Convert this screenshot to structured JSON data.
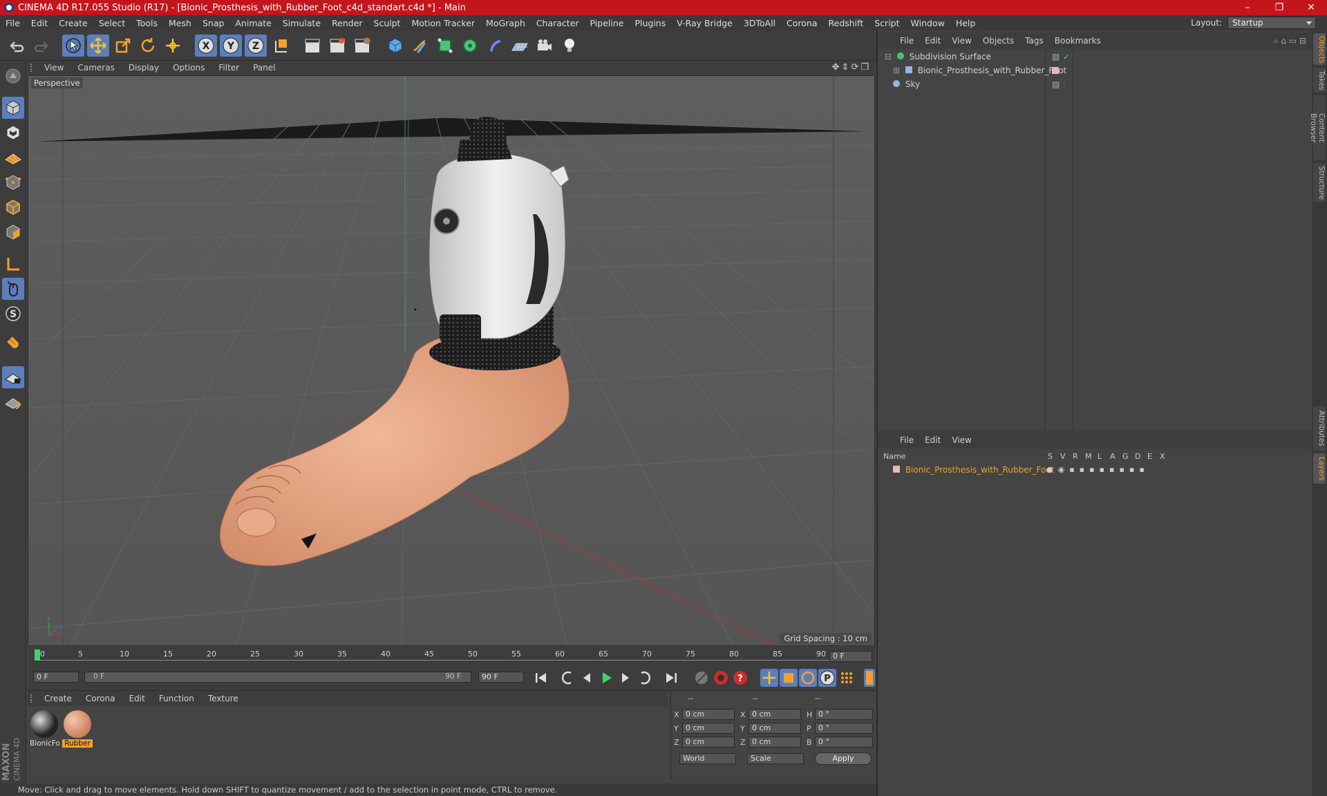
{
  "window": {
    "title": "CINEMA 4D R17.055 Studio (R17) - [Bionic_Prosthesis_with_Rubber_Foot_c4d_standart.c4d *] - Main"
  },
  "menu": [
    "File",
    "Edit",
    "Create",
    "Select",
    "Tools",
    "Mesh",
    "Snap",
    "Animate",
    "Simulate",
    "Render",
    "Sculpt",
    "Motion Tracker",
    "MoGraph",
    "Character",
    "Pipeline",
    "Plugins",
    "V-Ray Bridge",
    "3DToAll",
    "Corona",
    "Redshift",
    "Script",
    "Window",
    "Help"
  ],
  "layout": {
    "label": "Layout:",
    "value": "Startup"
  },
  "viewport": {
    "menu": [
      "View",
      "Cameras",
      "Display",
      "Options",
      "Filter",
      "Panel"
    ],
    "label": "Perspective",
    "grid_spacing": "Grid Spacing : 10 cm"
  },
  "timeline": {
    "ticks": [
      "0",
      "5",
      "10",
      "15",
      "20",
      "25",
      "30",
      "35",
      "40",
      "45",
      "50",
      "55",
      "60",
      "65",
      "70",
      "75",
      "80",
      "85",
      "90"
    ],
    "current_frame": "0 F",
    "start": "0 F",
    "range_start": "0 F",
    "range_end": "90 F",
    "end": "90 F"
  },
  "materials": {
    "menu": [
      "Create",
      "Corona",
      "Edit",
      "Function",
      "Texture"
    ],
    "items": [
      {
        "name": "BionicFo",
        "color": "#222222",
        "selected": false
      },
      {
        "name": "Rubber",
        "color": "#d98b6a",
        "selected": true
      }
    ]
  },
  "coords": {
    "headers": [
      "--",
      "--",
      "--"
    ],
    "rows": [
      {
        "a": "X",
        "av": "0 cm",
        "b": "X",
        "bv": "0 cm",
        "c": "H",
        "cv": "0 °"
      },
      {
        "a": "Y",
        "av": "0 cm",
        "b": "Y",
        "bv": "0 cm",
        "c": "P",
        "cv": "0 °"
      },
      {
        "a": "Z",
        "av": "0 cm",
        "b": "Z",
        "bv": "0 cm",
        "c": "B",
        "cv": "0 °"
      }
    ],
    "world": "World",
    "scale": "Scale",
    "apply": "Apply"
  },
  "status": "Move: Click and drag to move elements. Hold down SHIFT to quantize movement / add to the selection in point mode, CTRL to remove.",
  "objects": {
    "menu": [
      "File",
      "Edit",
      "View",
      "Objects",
      "Tags",
      "Bookmarks"
    ],
    "items": [
      {
        "name": "Subdivision Surface",
        "indent": 0
      },
      {
        "name": "Bionic_Prosthesis_with_Rubber_Foot",
        "indent": 1
      },
      {
        "name": "Sky",
        "indent": 0
      }
    ]
  },
  "layers": {
    "menu": [
      "File",
      "Edit",
      "View"
    ],
    "header_name": "Name",
    "columns": [
      "S",
      "V",
      "R",
      "M",
      "L",
      "A",
      "G",
      "D",
      "E",
      "X"
    ],
    "item": "Bionic_Prosthesis_with_Rubber_Foot"
  },
  "side_tabs": [
    "Objects",
    "Takes",
    "Content Browser",
    "Structure",
    "Attributes",
    "Layers"
  ],
  "brand": {
    "maxon": "MAXON",
    "c4d": "CINEMA 4D"
  },
  "colors": {
    "accent": "#5b7fbd",
    "title": "#c3161c",
    "layer_text": "#f0a030",
    "skin": "#e3a07e"
  }
}
